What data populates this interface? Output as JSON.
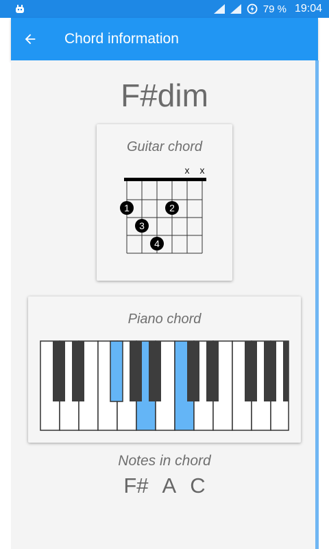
{
  "status_bar": {
    "battery": "79 %",
    "time": "19:04"
  },
  "app_bar": {
    "title": "Chord information"
  },
  "chord": {
    "name": "F#dim"
  },
  "guitar": {
    "title": "Guitar chord",
    "muted_strings_label": [
      "x",
      "x"
    ],
    "fingers": [
      {
        "label": "1"
      },
      {
        "label": "2"
      },
      {
        "label": "3"
      },
      {
        "label": "4"
      }
    ]
  },
  "piano": {
    "title": "Piano chord",
    "highlight_color": "#64b5f6"
  },
  "notes": {
    "heading": "Notes in chord",
    "items": [
      "F#",
      "A",
      "C"
    ]
  },
  "colors": {
    "primary": "#2196f3",
    "primary_dark": "#1e88e5",
    "background": "#f4f4f4"
  }
}
